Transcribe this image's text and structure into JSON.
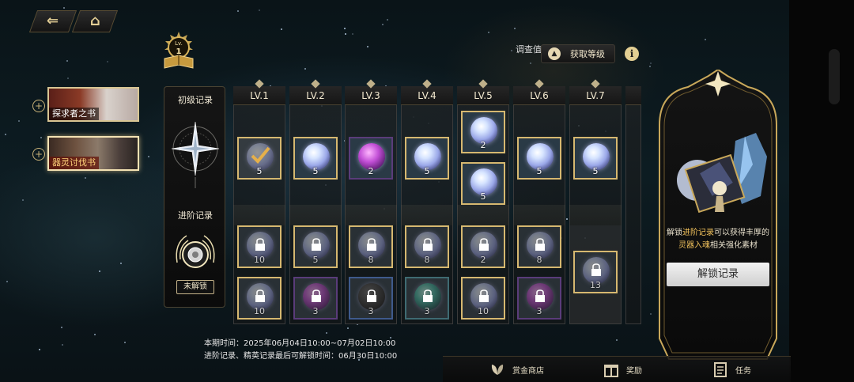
{
  "nav": {
    "back_icon": "back-arrow-icon",
    "home_icon": "home-icon"
  },
  "badge": {
    "text": "Lv.",
    "value": "1"
  },
  "header": {
    "investigation_label": "调查值",
    "gain_level_label": "获取等级",
    "info_label": "i"
  },
  "tabs": [
    {
      "label": "探求者之书",
      "selected": false
    },
    {
      "label": "器灵讨伐书",
      "selected": true
    }
  ],
  "records": {
    "basic_title": "初级记录",
    "advanced_title": "进阶记录",
    "locked_label": "未解锁"
  },
  "levels": [
    {
      "label": "LV.1",
      "basic": [
        {
          "count": "5",
          "orb": "white",
          "state": "claimed"
        }
      ],
      "advanced": [
        {
          "count": "10",
          "orb": "white",
          "state": "locked"
        },
        {
          "count": "10",
          "orb": "white",
          "state": "locked"
        }
      ]
    },
    {
      "label": "LV.2",
      "basic": [
        {
          "count": "5",
          "orb": "white",
          "state": "available"
        }
      ],
      "advanced": [
        {
          "count": "5",
          "orb": "white",
          "state": "locked"
        },
        {
          "count": "3",
          "orb": "purple",
          "state": "locked"
        }
      ]
    },
    {
      "label": "LV.3",
      "basic": [
        {
          "count": "2",
          "orb": "purple",
          "state": "available"
        }
      ],
      "advanced": [
        {
          "count": "8",
          "orb": "white",
          "state": "locked"
        },
        {
          "count": "3",
          "orb": "dark",
          "state": "locked"
        }
      ]
    },
    {
      "label": "LV.4",
      "basic": [
        {
          "count": "5",
          "orb": "white",
          "state": "available"
        }
      ],
      "advanced": [
        {
          "count": "8",
          "orb": "white",
          "state": "locked"
        },
        {
          "count": "3",
          "orb": "teal",
          "state": "locked"
        }
      ]
    },
    {
      "label": "LV.5",
      "basic": [
        {
          "count": "2",
          "orb": "white",
          "state": "available"
        },
        {
          "count": "5",
          "orb": "white",
          "state": "available"
        }
      ],
      "advanced": [
        {
          "count": "2",
          "orb": "white",
          "state": "locked"
        },
        {
          "count": "10",
          "orb": "white",
          "state": "locked"
        }
      ]
    },
    {
      "label": "LV.6",
      "basic": [
        {
          "count": "5",
          "orb": "white",
          "state": "available"
        }
      ],
      "advanced": [
        {
          "count": "8",
          "orb": "white",
          "state": "locked"
        },
        {
          "count": "3",
          "orb": "purple",
          "state": "locked"
        }
      ]
    },
    {
      "label": "LV.7",
      "basic": [
        {
          "count": "5",
          "orb": "white",
          "state": "available"
        }
      ],
      "advanced": [
        {
          "count": "13",
          "orb": "white",
          "state": "locked"
        }
      ]
    }
  ],
  "side": {
    "desc_prefix": "解锁",
    "desc_hl1": "进阶记录",
    "desc_mid": "可以获得丰厚的",
    "desc_hl2": "灵器入魂",
    "desc_suffix": "相关强化素材",
    "button_label": "解锁记录"
  },
  "footer": {
    "period_label": "本期时间：",
    "period_value": "2025年06月04日10:00~07月02日10:00",
    "advanced_deadline": "进阶记录、精英记录最后可解锁时间：06月30日10:00"
  },
  "bottom_nav": [
    {
      "label": "赏金商店",
      "icon": "leaf-shop-icon"
    },
    {
      "label": "奖励",
      "icon": "gift-icon"
    },
    {
      "label": "任务",
      "icon": "clipboard-icon"
    }
  ]
}
